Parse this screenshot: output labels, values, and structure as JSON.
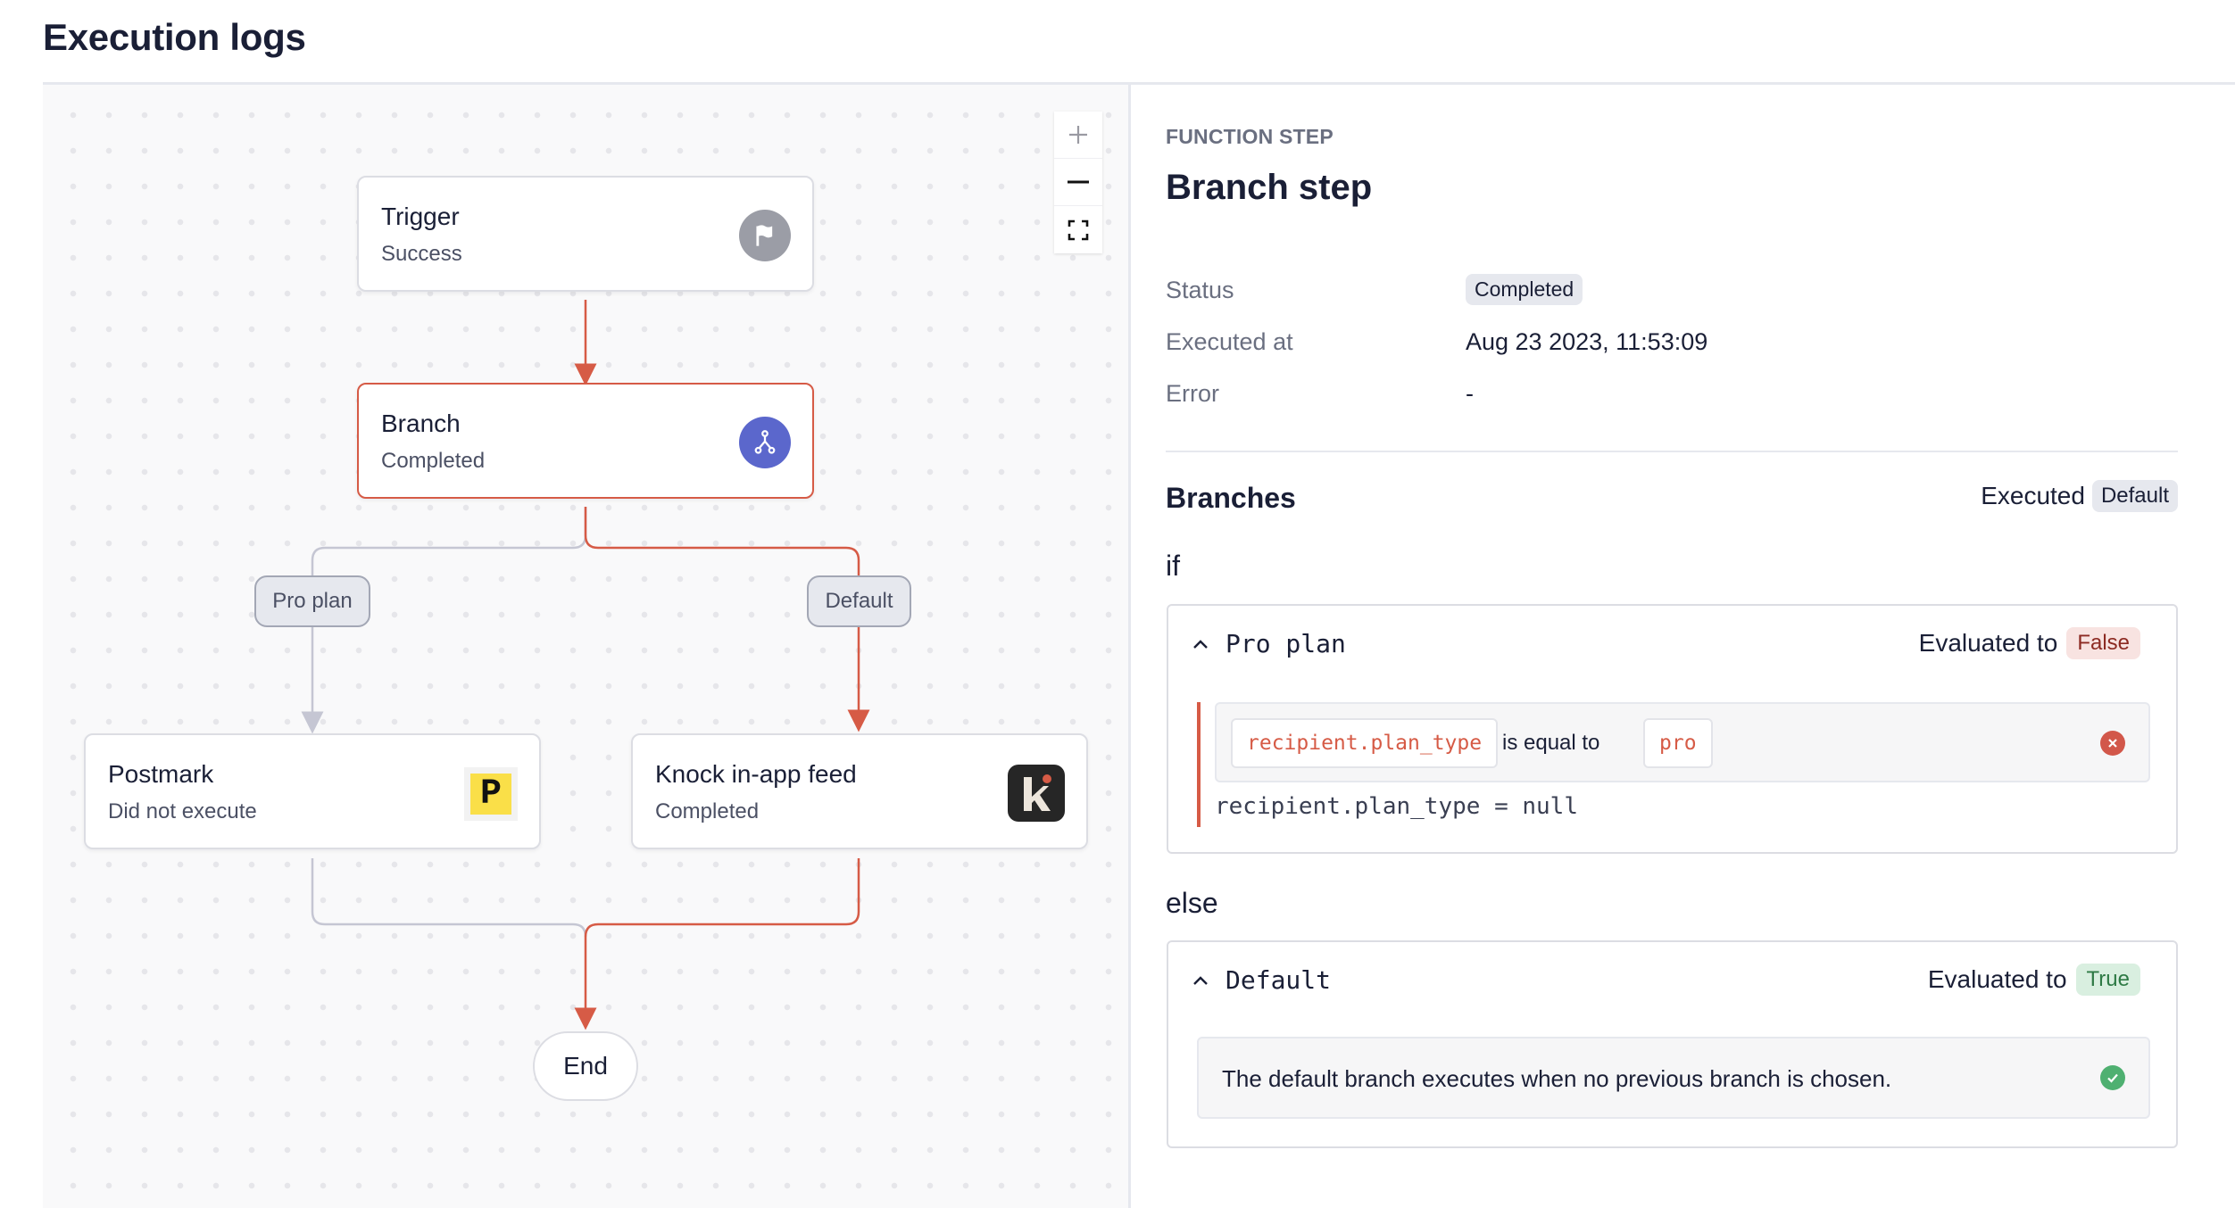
{
  "header": {
    "title": "Execution logs"
  },
  "canvas": {
    "zoom_controls": [
      {
        "name": "zoom-in",
        "icon": "plus-icon",
        "disabled": true
      },
      {
        "name": "zoom-out",
        "icon": "minus-icon",
        "disabled": false
      },
      {
        "name": "fit-view",
        "icon": "fullscreen-icon",
        "disabled": false
      }
    ],
    "nodes": {
      "trigger": {
        "title": "Trigger",
        "status": "Success",
        "icon": "flag-icon"
      },
      "branch": {
        "title": "Branch",
        "status": "Completed",
        "icon": "branch-icon"
      },
      "postmark": {
        "title": "Postmark",
        "status": "Did not execute",
        "icon": "postmark-logo-icon",
        "icon_letter": "P"
      },
      "knock": {
        "title": "Knock in-app feed",
        "status": "Completed",
        "icon": "knock-logo-icon",
        "icon_letter": "k"
      },
      "end": {
        "title": "End"
      }
    },
    "edge_labels": {
      "pro_plan": "Pro plan",
      "default": "Default"
    },
    "colors": {
      "active_path": "#d65b46",
      "inactive_path": "#c5c6d3",
      "branch_icon_bg": "#5b67cc",
      "trigger_icon_bg": "#9b9da6"
    }
  },
  "detail": {
    "kicker": "FUNCTION STEP",
    "title": "Branch step",
    "meta": {
      "status_label": "Status",
      "status_value": "Completed",
      "executed_label": "Executed at",
      "executed_value": "Aug 23 2023, 11:53:09",
      "error_label": "Error",
      "error_value": "-"
    },
    "branches": {
      "title": "Branches",
      "executed_label": "Executed",
      "executed_value": "Default",
      "if_keyword": "if",
      "else_keyword": "else",
      "pro_plan": {
        "name": "Pro plan",
        "evaluated_label": "Evaluated to",
        "evaluated_value": "False",
        "condition": {
          "variable": "recipient.plan_type",
          "operator": "is equal to",
          "value": "pro",
          "result": "recipient.plan_type = null"
        }
      },
      "default": {
        "name": "Default",
        "evaluated_label": "Evaluated to",
        "evaluated_value": "True",
        "description": "The default branch executes when no previous branch is chosen."
      }
    }
  }
}
